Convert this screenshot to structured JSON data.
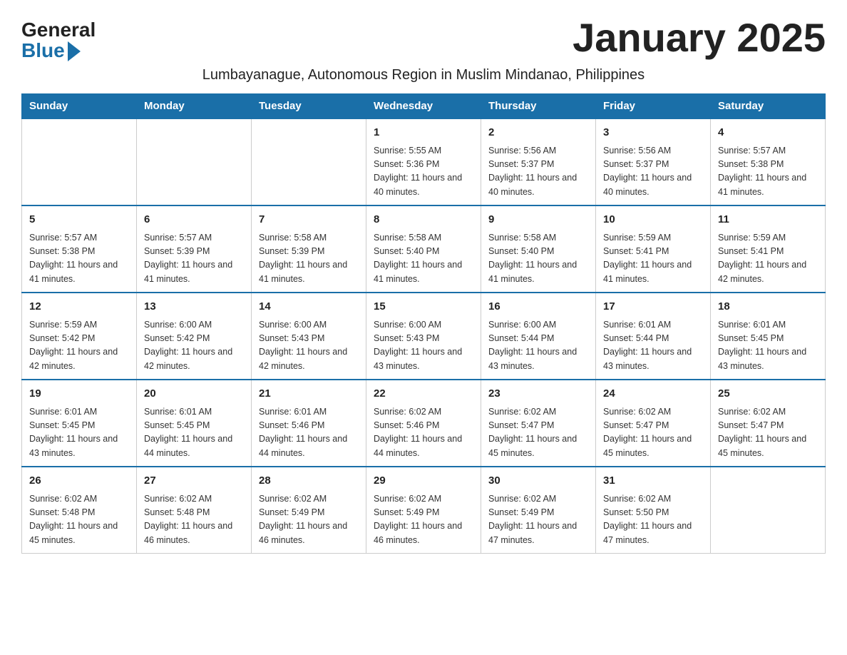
{
  "logo": {
    "general": "General",
    "blue": "Blue"
  },
  "title": "January 2025",
  "subtitle": "Lumbayanague, Autonomous Region in Muslim Mindanao, Philippines",
  "days_of_week": [
    "Sunday",
    "Monday",
    "Tuesday",
    "Wednesday",
    "Thursday",
    "Friday",
    "Saturday"
  ],
  "weeks": [
    [
      {
        "day": "",
        "info": ""
      },
      {
        "day": "",
        "info": ""
      },
      {
        "day": "",
        "info": ""
      },
      {
        "day": "1",
        "info": "Sunrise: 5:55 AM\nSunset: 5:36 PM\nDaylight: 11 hours and 40 minutes."
      },
      {
        "day": "2",
        "info": "Sunrise: 5:56 AM\nSunset: 5:37 PM\nDaylight: 11 hours and 40 minutes."
      },
      {
        "day": "3",
        "info": "Sunrise: 5:56 AM\nSunset: 5:37 PM\nDaylight: 11 hours and 40 minutes."
      },
      {
        "day": "4",
        "info": "Sunrise: 5:57 AM\nSunset: 5:38 PM\nDaylight: 11 hours and 41 minutes."
      }
    ],
    [
      {
        "day": "5",
        "info": "Sunrise: 5:57 AM\nSunset: 5:38 PM\nDaylight: 11 hours and 41 minutes."
      },
      {
        "day": "6",
        "info": "Sunrise: 5:57 AM\nSunset: 5:39 PM\nDaylight: 11 hours and 41 minutes."
      },
      {
        "day": "7",
        "info": "Sunrise: 5:58 AM\nSunset: 5:39 PM\nDaylight: 11 hours and 41 minutes."
      },
      {
        "day": "8",
        "info": "Sunrise: 5:58 AM\nSunset: 5:40 PM\nDaylight: 11 hours and 41 minutes."
      },
      {
        "day": "9",
        "info": "Sunrise: 5:58 AM\nSunset: 5:40 PM\nDaylight: 11 hours and 41 minutes."
      },
      {
        "day": "10",
        "info": "Sunrise: 5:59 AM\nSunset: 5:41 PM\nDaylight: 11 hours and 41 minutes."
      },
      {
        "day": "11",
        "info": "Sunrise: 5:59 AM\nSunset: 5:41 PM\nDaylight: 11 hours and 42 minutes."
      }
    ],
    [
      {
        "day": "12",
        "info": "Sunrise: 5:59 AM\nSunset: 5:42 PM\nDaylight: 11 hours and 42 minutes."
      },
      {
        "day": "13",
        "info": "Sunrise: 6:00 AM\nSunset: 5:42 PM\nDaylight: 11 hours and 42 minutes."
      },
      {
        "day": "14",
        "info": "Sunrise: 6:00 AM\nSunset: 5:43 PM\nDaylight: 11 hours and 42 minutes."
      },
      {
        "day": "15",
        "info": "Sunrise: 6:00 AM\nSunset: 5:43 PM\nDaylight: 11 hours and 43 minutes."
      },
      {
        "day": "16",
        "info": "Sunrise: 6:00 AM\nSunset: 5:44 PM\nDaylight: 11 hours and 43 minutes."
      },
      {
        "day": "17",
        "info": "Sunrise: 6:01 AM\nSunset: 5:44 PM\nDaylight: 11 hours and 43 minutes."
      },
      {
        "day": "18",
        "info": "Sunrise: 6:01 AM\nSunset: 5:45 PM\nDaylight: 11 hours and 43 minutes."
      }
    ],
    [
      {
        "day": "19",
        "info": "Sunrise: 6:01 AM\nSunset: 5:45 PM\nDaylight: 11 hours and 43 minutes."
      },
      {
        "day": "20",
        "info": "Sunrise: 6:01 AM\nSunset: 5:45 PM\nDaylight: 11 hours and 44 minutes."
      },
      {
        "day": "21",
        "info": "Sunrise: 6:01 AM\nSunset: 5:46 PM\nDaylight: 11 hours and 44 minutes."
      },
      {
        "day": "22",
        "info": "Sunrise: 6:02 AM\nSunset: 5:46 PM\nDaylight: 11 hours and 44 minutes."
      },
      {
        "day": "23",
        "info": "Sunrise: 6:02 AM\nSunset: 5:47 PM\nDaylight: 11 hours and 45 minutes."
      },
      {
        "day": "24",
        "info": "Sunrise: 6:02 AM\nSunset: 5:47 PM\nDaylight: 11 hours and 45 minutes."
      },
      {
        "day": "25",
        "info": "Sunrise: 6:02 AM\nSunset: 5:47 PM\nDaylight: 11 hours and 45 minutes."
      }
    ],
    [
      {
        "day": "26",
        "info": "Sunrise: 6:02 AM\nSunset: 5:48 PM\nDaylight: 11 hours and 45 minutes."
      },
      {
        "day": "27",
        "info": "Sunrise: 6:02 AM\nSunset: 5:48 PM\nDaylight: 11 hours and 46 minutes."
      },
      {
        "day": "28",
        "info": "Sunrise: 6:02 AM\nSunset: 5:49 PM\nDaylight: 11 hours and 46 minutes."
      },
      {
        "day": "29",
        "info": "Sunrise: 6:02 AM\nSunset: 5:49 PM\nDaylight: 11 hours and 46 minutes."
      },
      {
        "day": "30",
        "info": "Sunrise: 6:02 AM\nSunset: 5:49 PM\nDaylight: 11 hours and 47 minutes."
      },
      {
        "day": "31",
        "info": "Sunrise: 6:02 AM\nSunset: 5:50 PM\nDaylight: 11 hours and 47 minutes."
      },
      {
        "day": "",
        "info": ""
      }
    ]
  ]
}
